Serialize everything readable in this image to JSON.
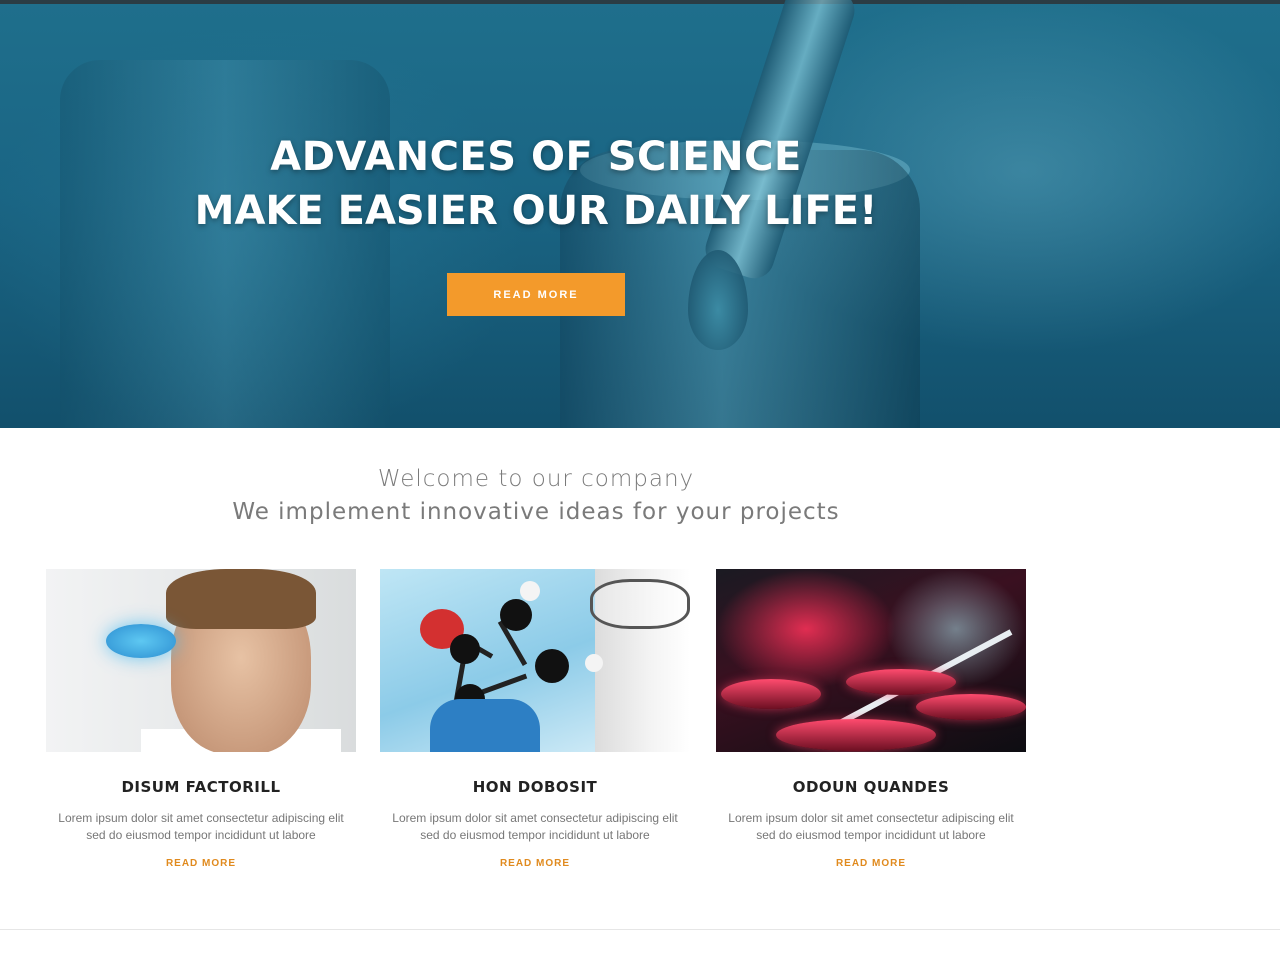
{
  "hero": {
    "title": "ADVANCES OF SCIENCE",
    "subtitle": "MAKE EASIER OUR DAILY LIFE!",
    "button_label": "READ MORE"
  },
  "welcome": {
    "line1": "Welcome to our company",
    "line2": "We implement innovative ideas for your projects"
  },
  "cards": [
    {
      "title": "DISUM FACTORILL",
      "text": "Lorem ipsum dolor sit amet consectetur adipiscing elit sed do eiusmod tempor incididunt ut labore",
      "link": "READ MORE",
      "image": "scientist-with-flask"
    },
    {
      "title": "HON DOBOSIT",
      "text": "Lorem ipsum dolor sit amet consectetur adipiscing elit sed do eiusmod tempor incididunt ut labore",
      "link": "READ MORE",
      "image": "molecule-model"
    },
    {
      "title": "ODOUN QUANDES",
      "text": "Lorem ipsum dolor sit amet consectetur adipiscing elit sed do eiusmod tempor incididunt ut labore",
      "link": "READ MORE",
      "image": "petri-dishes"
    }
  ],
  "colors": {
    "accent": "#f39a2b",
    "hero_bg": "#1a6584",
    "link": "#e08a1e"
  }
}
